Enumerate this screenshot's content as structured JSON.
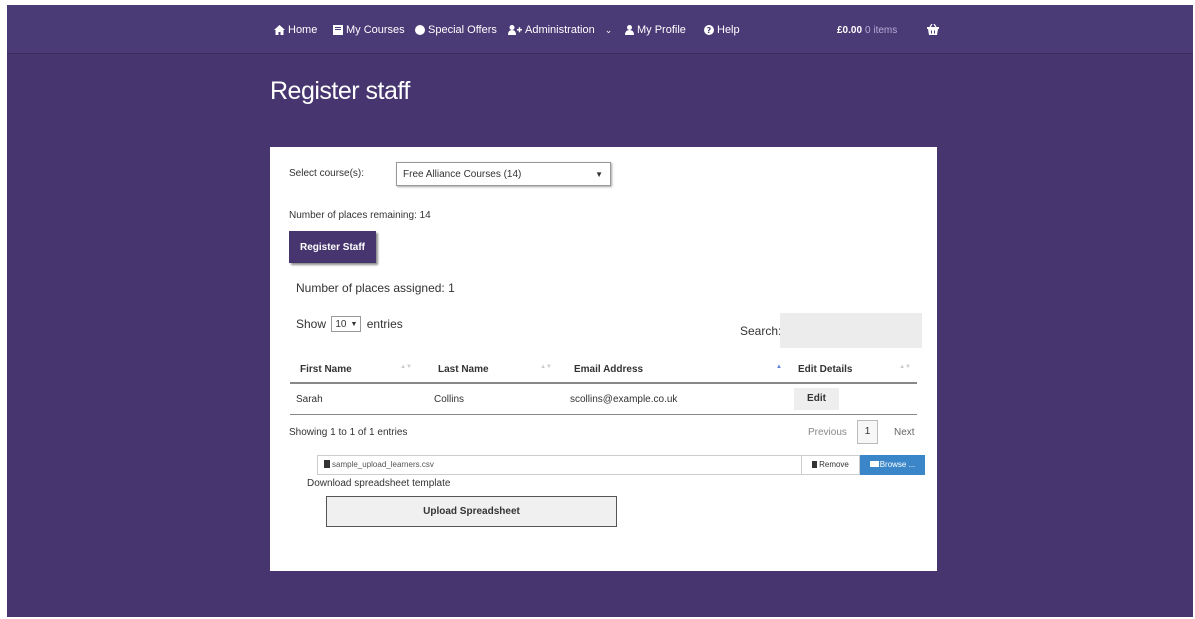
{
  "nav": {
    "home": "Home",
    "my_courses": "My Courses",
    "special_offers": "Special Offers",
    "administration": "Administration",
    "my_profile": "My Profile",
    "help": "Help",
    "cart_total": "£0.00",
    "cart_count": "0 items",
    "icons": [
      "home-icon",
      "book-icon",
      "circle-icon",
      "user-plus-icon",
      "user-icon",
      "question-icon",
      "basket-icon"
    ]
  },
  "page": {
    "title": "Register staff"
  },
  "form": {
    "select_label": "Select course(s):",
    "selected_course": "Free Alliance Courses (14)",
    "places_remaining": "Number of places remaining: 14",
    "register_button": "Register Staff",
    "places_assigned": "Number of places assigned: 1"
  },
  "table": {
    "show_label": "Show",
    "entries_label": "entries",
    "page_length": "10",
    "search_label": "Search:",
    "headers": [
      "First Name",
      "Last Name",
      "Email Address",
      "Edit Details"
    ],
    "rows": [
      {
        "first": "Sarah",
        "last": "Collins",
        "email": "scollins@example.co.uk",
        "action": "Edit"
      }
    ],
    "info": "Showing 1 to 1 of 1 entries",
    "previous": "Previous",
    "current_page": "1",
    "next": "Next"
  },
  "upload": {
    "filename": "sample_upload_learners.csv",
    "remove": "Remove",
    "browse": "Browse ...",
    "template_link": "Download spreadsheet template",
    "upload_button": "Upload Spreadsheet"
  },
  "colors": {
    "page_bg": "#46356f",
    "nav_bg": "#4a3a75",
    "button_bg": "#46356f",
    "browse_bg": "#3a86c9"
  }
}
